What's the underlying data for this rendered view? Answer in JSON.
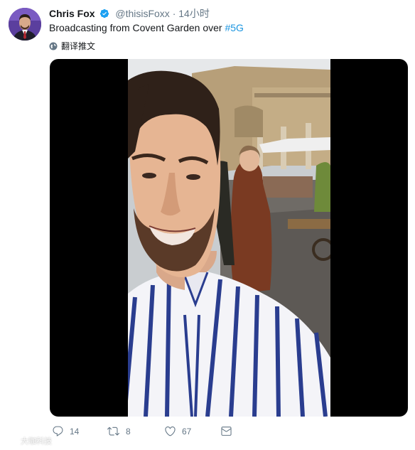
{
  "author": {
    "name": "Chris Fox",
    "handle": "@thisisFoxx",
    "separator": "·",
    "time": "14小时"
  },
  "tweet": {
    "text": "Broadcasting from Covent Garden over ",
    "hashtag": "#5G",
    "translate_label": "翻译推文"
  },
  "actions": {
    "reply_count": "14",
    "retweet_count": "8",
    "like_count": "67"
  },
  "watermark": {
    "text": "大咖科技"
  },
  "colors": {
    "link": "#1b95e0",
    "verified": "#1da1f2",
    "secondary_text": "#657786"
  }
}
